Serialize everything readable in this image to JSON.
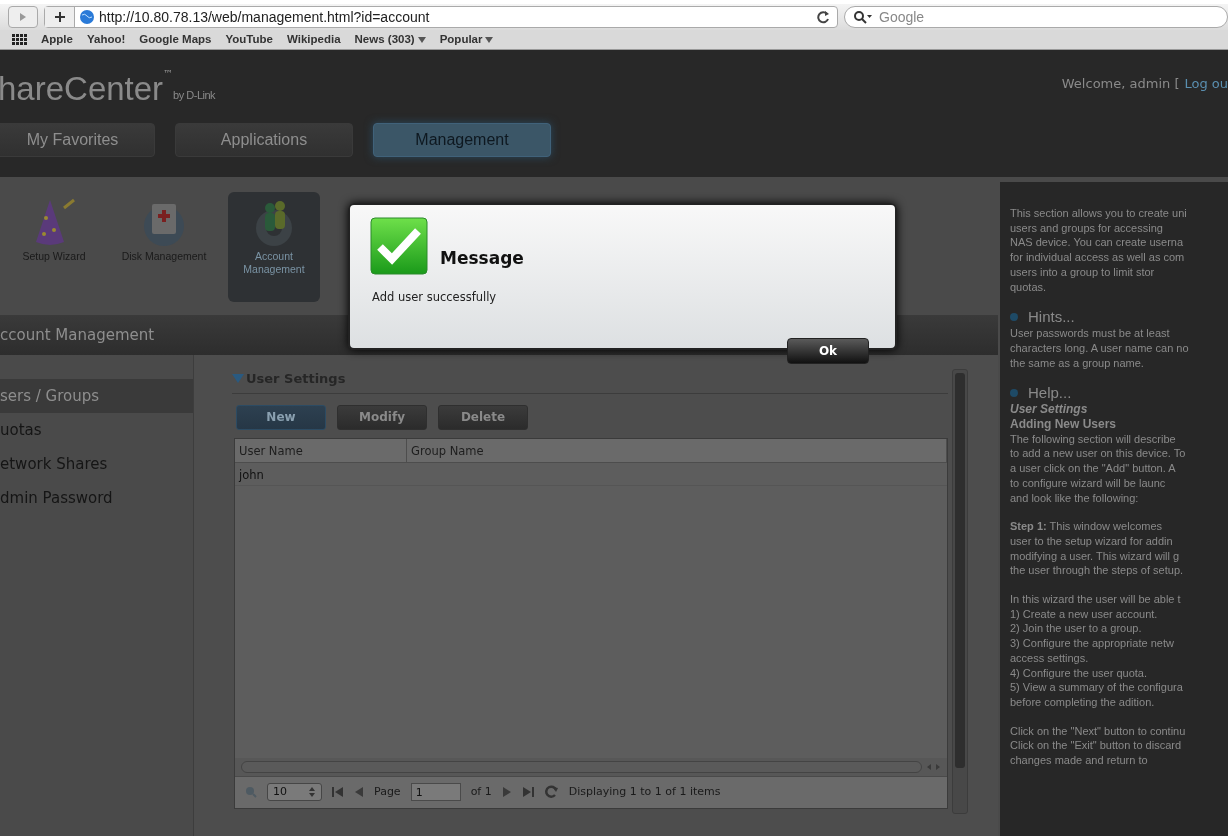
{
  "browser": {
    "url": "http://10.80.78.13/web/management.html?id=account",
    "search_placeholder": "Google",
    "bookmarks": [
      {
        "label": "Apple",
        "has_menu": false
      },
      {
        "label": "Yahoo!",
        "has_menu": false
      },
      {
        "label": "Google Maps",
        "has_menu": false
      },
      {
        "label": "YouTube",
        "has_menu": false
      },
      {
        "label": "Wikipedia",
        "has_menu": false
      },
      {
        "label": "News (303)",
        "has_menu": true
      },
      {
        "label": "Popular",
        "has_menu": true
      }
    ]
  },
  "header": {
    "logo": "hareCenter",
    "trademark": "™",
    "byline": "by D-Link",
    "welcome": "Welcome, admin [",
    "logout": "Log ou",
    "tabs": [
      {
        "label": "My Favorites",
        "selected": false
      },
      {
        "label": "Applications",
        "selected": false
      },
      {
        "label": "Management",
        "selected": true
      }
    ]
  },
  "apps": [
    {
      "kind": "wizard",
      "label": "Setup Wizard",
      "selected": false
    },
    {
      "kind": "disk",
      "label": "Disk Management",
      "selected": false
    },
    {
      "kind": "account",
      "label": "Account Management",
      "selected": true
    }
  ],
  "section_title": "ccount Management",
  "sidebar": {
    "items": [
      {
        "label": "sers / Groups",
        "selected": true
      },
      {
        "label": "uotas",
        "selected": false
      },
      {
        "label": "etwork Shares",
        "selected": false
      },
      {
        "label": "dmin Password",
        "selected": false
      }
    ]
  },
  "user_settings": {
    "title": "User Settings",
    "expanded": true,
    "buttons": [
      {
        "label": "New",
        "selected": true
      },
      {
        "label": "Modify",
        "selected": false
      },
      {
        "label": "Delete",
        "selected": false
      }
    ],
    "table": {
      "columns": [
        "User Name",
        "Group Name"
      ],
      "rows": [
        {
          "cells": [
            "john"
          ]
        }
      ]
    },
    "pager": {
      "page_size": "10",
      "page_label": "Page",
      "page": "1",
      "of": "of 1",
      "status": "Displaying 1 to 1 of 1 items"
    }
  },
  "help_panel": {
    "intro": "This section allows you to create uni\nusers and groups for accessing\nNAS device. You can create userna\nfor individual access as well as com\nusers into a group to limit stor\nquotas.",
    "hints_title": "Hints...",
    "hints": "User passwords must be at least\ncharacters long. A user name can no\nthe same as a group name.",
    "help_title": "Help...",
    "help_subtitle": "User Settings",
    "help_heading": "Adding New Users",
    "paragraphs": [
      "The following section will describe\nto add a new user on this device. To\na user click on the \"Add\" button. A\nto configure wizard will be launc\nand look like the following:",
      "**Step 1:** This window welcomes\nuser to the setup wizard for addin\nmodifying a user. This wizard will g\nthe user through the steps of setup.",
      "In this wizard the user will be able t\n1) Create a new user account.\n2) Join the user to a group.\n3) Configure the appropriate netw\naccess settings.\n4) Configure the user quota.\n5) View a summary of the configura\nbefore completing the adition.",
      "Click on the \"Next\" button to continu\nClick on the \"Exit\" button to discard\nchanges made and return to"
    ]
  },
  "dialog": {
    "title": "Message",
    "text": "Add user successfully",
    "ok": "Ok"
  }
}
